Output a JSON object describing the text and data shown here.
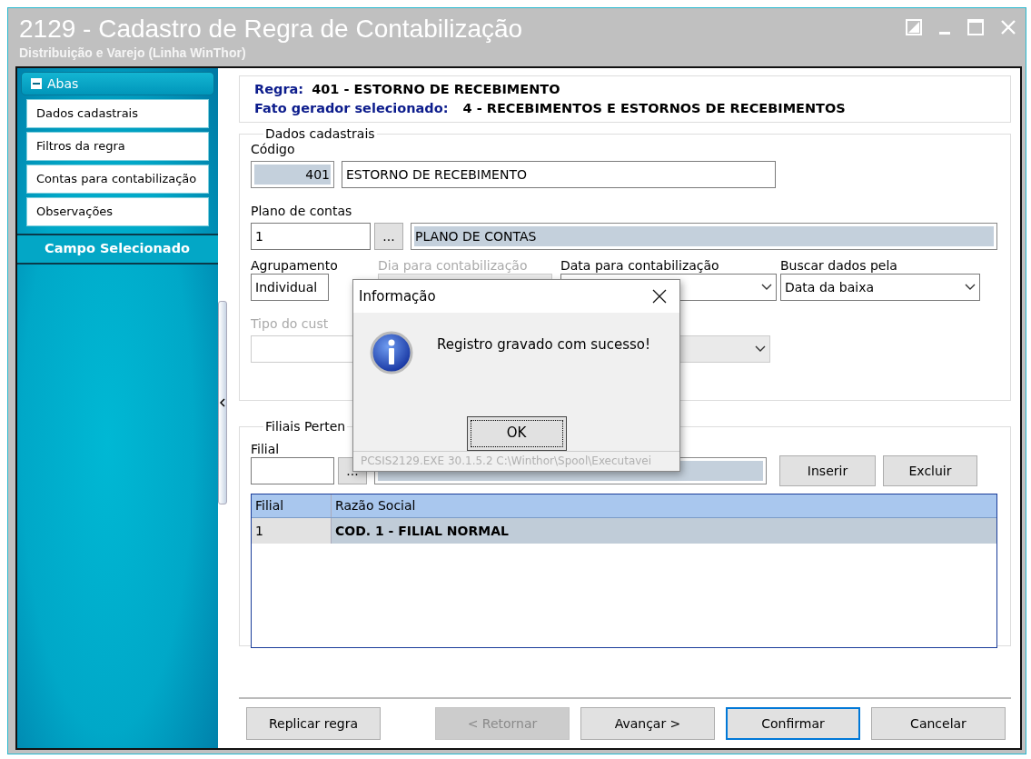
{
  "window": {
    "title": "2129 - Cadastro de Regra de Contabilização",
    "subtitle": "Distribuição e Varejo (Linha WinThor)"
  },
  "sidebar": {
    "header": "Abas",
    "expanded": true,
    "items": [
      {
        "label": "Dados cadastrais"
      },
      {
        "label": "Filtros da regra"
      },
      {
        "label": "Contas para contabilização"
      },
      {
        "label": "Observações"
      }
    ],
    "section": "Campo Selecionado"
  },
  "rule_header": {
    "rule_label": "Regra:",
    "rule_value": "401 - ESTORNO DE RECEBIMENTO",
    "event_label": "Fato gerador selecionado:",
    "event_value": "4 - RECEBIMENTOS E ESTORNOS DE RECEBIMENTOS"
  },
  "main_group": {
    "title": "Dados cadastrais",
    "code_label": "Código",
    "code": "401",
    "description": "ESTORNO DE RECEBIMENTO",
    "chart_label": "Plano de contas",
    "chart_code": "1",
    "lookup_button": "...",
    "chart_name": "PLANO DE CONTAS",
    "combos": [
      {
        "label": "Agrupamento",
        "value": "Individual",
        "disabled": false
      },
      {
        "label": "Dia para contabilização",
        "disabled": true
      },
      {
        "label": "Data para contabilização",
        "disabled": false
      },
      {
        "label": "Buscar dados pela",
        "value": "Data da baixa",
        "disabled": false
      }
    ],
    "cost_label": "Tipo do cust",
    "cost_disabled": true
  },
  "branches": {
    "title": "Filiais Perten",
    "field_label": "Filial",
    "lookup_button": "...",
    "buttons": [
      "Inserir",
      "Excluir"
    ],
    "columns": [
      "Filial",
      "Razão Social"
    ],
    "rows": [
      {
        "cells": [
          "1",
          "COD. 1 - FILIAL NORMAL"
        ],
        "selected": true
      }
    ]
  },
  "footer_buttons": [
    {
      "label": "Replicar regra",
      "disabled": false,
      "focused": false
    },
    {
      "label": "< Retornar",
      "disabled": true,
      "focused": false
    },
    {
      "label": "Avançar >",
      "disabled": false,
      "focused": false
    },
    {
      "label": "Confirmar",
      "disabled": false,
      "focused": true
    },
    {
      "label": "Cancelar",
      "disabled": false,
      "focused": false
    }
  ],
  "dialog": {
    "title": "Informação",
    "message": "Registro gravado com sucesso!",
    "button": "OK",
    "footer": "PCSIS2129.EXE 30.1.5.2 C:\\Winthor\\Spool\\Executavei"
  }
}
